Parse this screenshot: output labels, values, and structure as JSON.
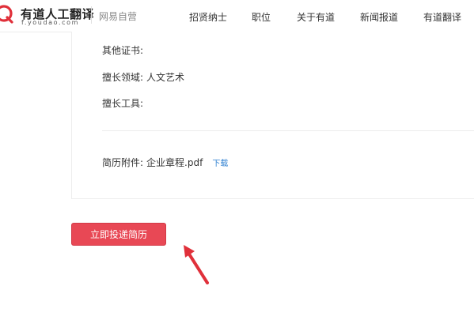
{
  "header": {
    "brand": "有道人工翻译",
    "domain": "f.youdao.com",
    "subbrand": "网易自营",
    "nav": [
      {
        "label": "招贤纳士"
      },
      {
        "label": "职位"
      },
      {
        "label": "关于有道"
      },
      {
        "label": "新闻报道"
      },
      {
        "label": "有道翻译"
      }
    ]
  },
  "resume": {
    "other_certs_label": "其他证书:",
    "other_certs_value": "",
    "expertise_label": "擅长领域:",
    "expertise_value": "人文艺术",
    "tools_label": "擅长工具:",
    "tools_value": "",
    "attachment_label": "简历附件:",
    "attachment_file": "企业章程.pdf",
    "download_label": "下载"
  },
  "actions": {
    "apply_label": "立即投递简历"
  },
  "colors": {
    "brand_red": "#e84855",
    "link_blue": "#2f80d1",
    "annotation_arrow": "#e0303a"
  },
  "icons": {
    "logo": "youdao-logo-icon",
    "annotation": "red-arrow-icon"
  }
}
